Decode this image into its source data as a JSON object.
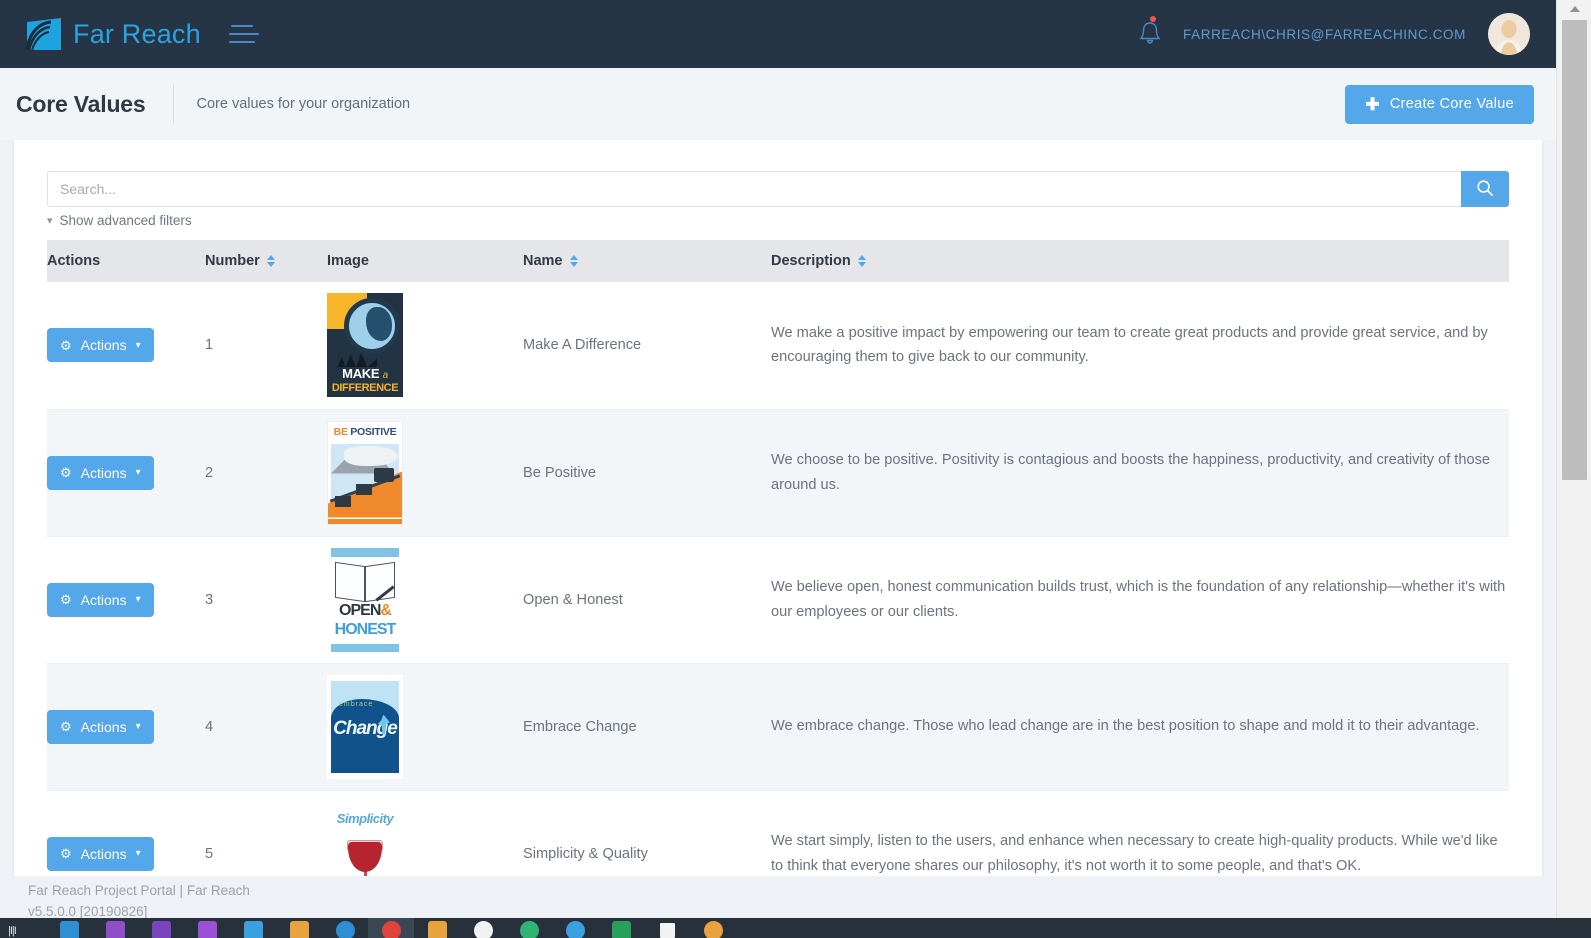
{
  "topnav": {
    "brand_name": "Far Reach",
    "brand_logo_icon": "far-reach-logo-icon",
    "menu_icon": "hamburger-menu-icon",
    "notification_icon": "bell-icon",
    "user_email": "FARREACH\\CHRIS@FARREACHINC.COM",
    "avatar_icon": "user-avatar-icon"
  },
  "pagehead": {
    "title": "Core Values",
    "subtitle": "Core values for your organization",
    "create_button": {
      "label": "Create Core Value",
      "icon": "plus-icon"
    }
  },
  "search": {
    "placeholder": "Search...",
    "value": "",
    "button_icon": "search-icon",
    "advanced_filters_label": "Show advanced filters",
    "advanced_filters_icon": "chevron-down-icon"
  },
  "table": {
    "columns": [
      {
        "label": "Actions",
        "sortable": false
      },
      {
        "label": "Number",
        "sortable": true
      },
      {
        "label": "Image",
        "sortable": false
      },
      {
        "label": "Name",
        "sortable": true
      },
      {
        "label": "Description",
        "sortable": true
      }
    ],
    "row_action_label": "Actions",
    "row_action_icon": "gear-icon",
    "row_action_caret": "chevron-down-icon",
    "rows": [
      {
        "number": "1",
        "image_name": "make-a-difference-poster",
        "image_caption_top": "MAKE",
        "image_caption_mid": "a",
        "image_caption_bottom": "DIFFERENCE",
        "name": "Make A Difference",
        "description": "We make a positive impact by empowering our team to create great products and provide great service, and by encouraging them to give back to our community."
      },
      {
        "number": "2",
        "image_name": "be-positive-poster",
        "image_caption_top": "BE",
        "image_caption_mid": "POSITIVE",
        "image_caption_bottom": "",
        "name": "Be Positive",
        "description": "We choose to be positive. Positivity is contagious and boosts the happiness, productivity, and creativity of those around us."
      },
      {
        "number": "3",
        "image_name": "open-and-honest-poster",
        "image_caption_top": "OPEN",
        "image_caption_mid": "&",
        "image_caption_bottom": "HONEST",
        "name": "Open & Honest",
        "description": "We believe open, honest communication builds trust, which is the foundation of any relationship—whether it's with our employees or our clients."
      },
      {
        "number": "4",
        "image_name": "embrace-change-poster",
        "image_caption_top": "embrace",
        "image_caption_mid": "Change",
        "image_caption_bottom": "",
        "name": "Embrace Change",
        "description": "We embrace change. Those who lead change are in the best position to shape and mold it to their advantage."
      },
      {
        "number": "5",
        "image_name": "simplicity-and-quality-poster",
        "image_caption_top": "Simplicity",
        "image_caption_mid": "",
        "image_caption_bottom": "",
        "name": "Simplicity & Quality",
        "description": "We start simply, listen to the users, and enhance when necessary to create high-quality products. While we'd like to think that everyone shares our philosophy, it's not worth it to some people, and that's OK."
      }
    ]
  },
  "footer": {
    "line1": "Far Reach Project Portal | Far Reach",
    "line2": "v5.5.0.0 [20190826]"
  },
  "scrollbar": {
    "up_arrow_icon": "scroll-up-arrow-icon",
    "thumb_name": "vertical-scrollbar-thumb"
  },
  "taskbar": {
    "start_label": "|I|I",
    "items": [
      {
        "name": "taskbar-file-explorer",
        "color": "#2f8fd4",
        "active": false
      },
      {
        "name": "taskbar-app-purple-1",
        "color": "#8e4fc9",
        "active": false
      },
      {
        "name": "taskbar-app-purple-2",
        "color": "#7a44bf",
        "active": false
      },
      {
        "name": "taskbar-app-purple-3",
        "color": "#9b51d6",
        "active": false
      },
      {
        "name": "taskbar-app-blue-cone",
        "color": "#3aa0e0",
        "active": false
      },
      {
        "name": "taskbar-app-orange",
        "color": "#e8a33d",
        "active": false
      },
      {
        "name": "taskbar-app-blue-dot",
        "color": "#2f8fd4",
        "active": false
      },
      {
        "name": "taskbar-app-red-rec",
        "color": "#e0443b",
        "active": true
      },
      {
        "name": "taskbar-app-folder",
        "color": "#e8a33d",
        "active": false
      },
      {
        "name": "taskbar-app-white",
        "color": "#f2f2f2",
        "active": false
      },
      {
        "name": "taskbar-app-green",
        "color": "#2fb573",
        "active": false
      },
      {
        "name": "taskbar-app-cyan",
        "color": "#3aa0e0",
        "active": false
      },
      {
        "name": "taskbar-app-excel",
        "color": "#27a05a",
        "active": false
      },
      {
        "name": "taskbar-app-window",
        "color": "#f2f2f2",
        "active": false
      },
      {
        "name": "taskbar-app-amber",
        "color": "#e8a33d",
        "active": false
      }
    ]
  },
  "colors": {
    "accent": "#54a7e8",
    "navbar": "#263545",
    "page_bg": "#eef1f5",
    "row_alt": "#f3f6f9",
    "header_row": "#e4e6e9"
  }
}
